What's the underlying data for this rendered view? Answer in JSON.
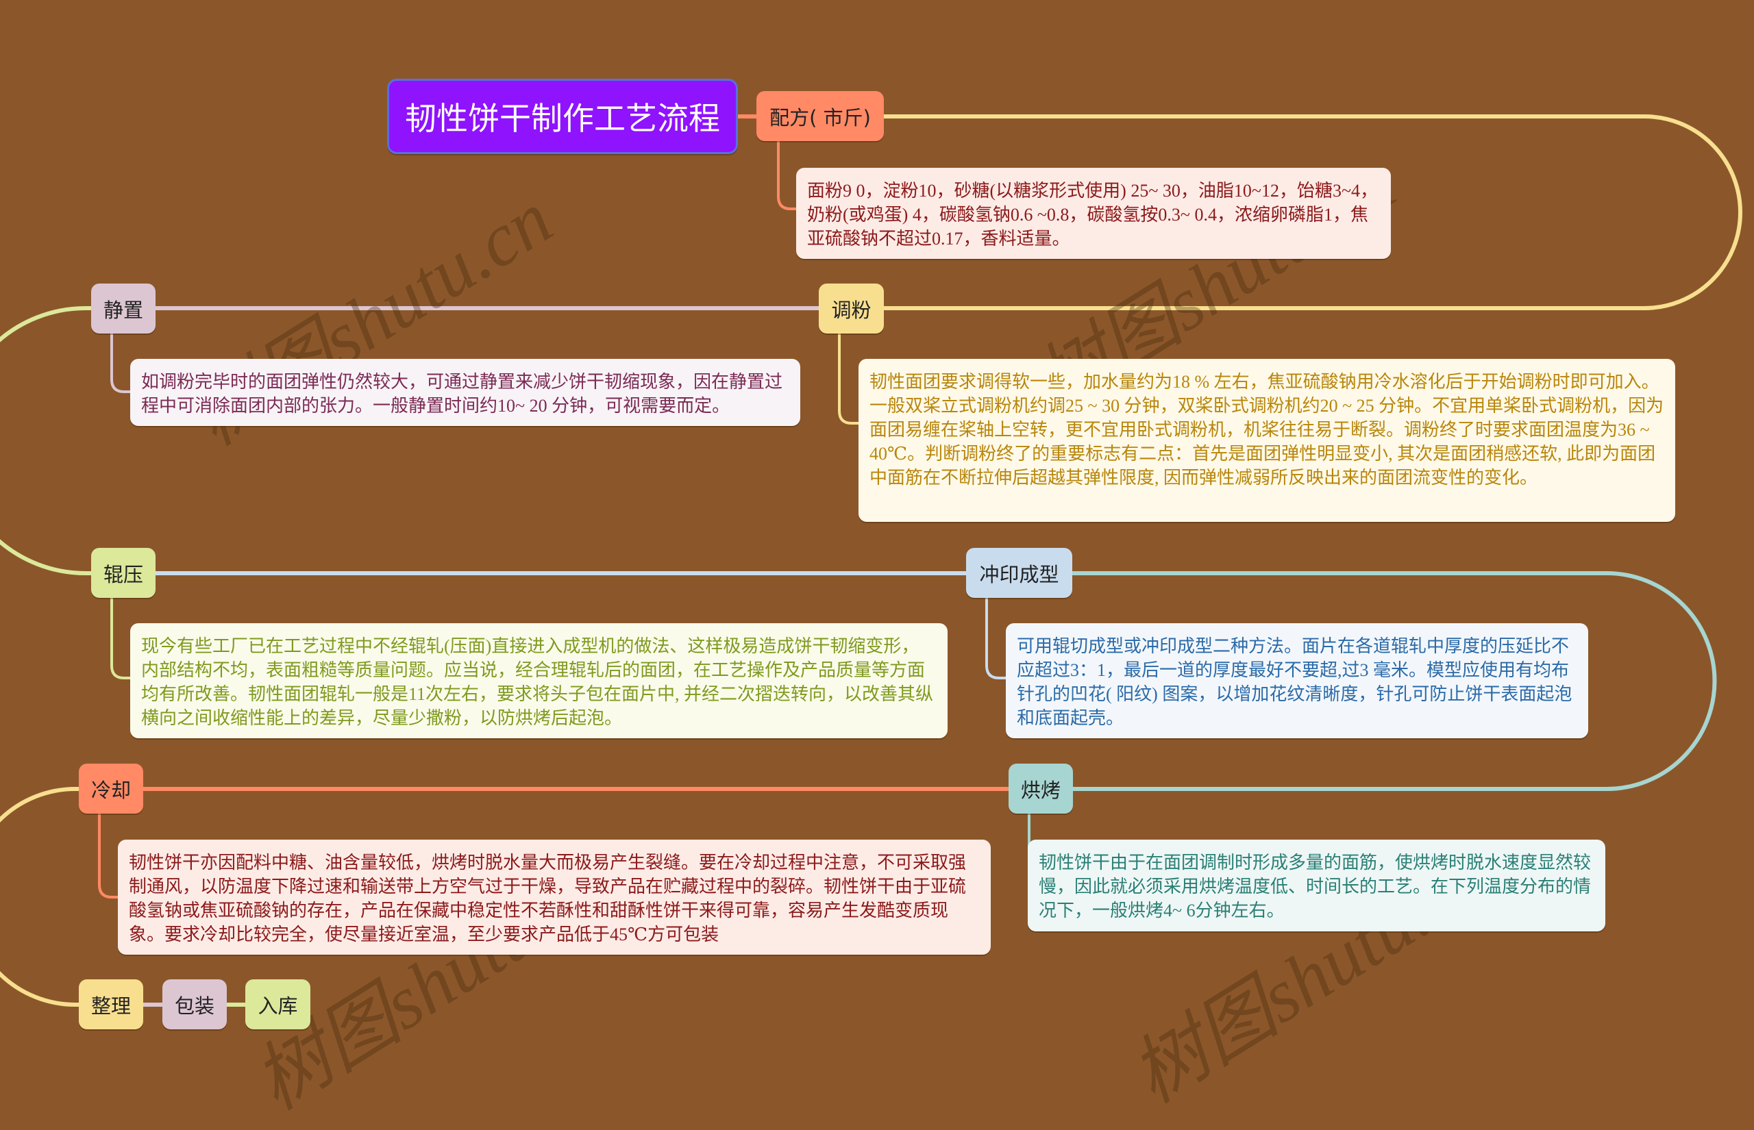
{
  "root": {
    "label": "韧性饼干制作工艺流程",
    "color": "#8F13FD"
  },
  "nodes": [
    {
      "id": "peifang",
      "label": "配方( 市斤)",
      "color": "#FF8A65",
      "detail": "面粉9 0，淀粉10，砂糖(以糖浆形式使用) 25~ 30，油脂10~12，饴糖3~4，奶粉(或鸡蛋) 4，碳酸氢钠0.6 ~0.8，碳酸氢按0.3~ 0.4，浓缩卵磷脂1，焦亚硫酸钠不超过0.17，香料适量。",
      "detail_bg": "#FDEBE6",
      "detail_color": "#8B1A1A"
    },
    {
      "id": "tiaofen",
      "label": "调粉",
      "color": "#F8DF8F",
      "detail": "韧性面团要求调得软一些，加水量约为18 % 左右，焦亚硫酸钠用冷水溶化后于开始调粉时即可加入。一般双桨立式调粉机约调25 ~ 30 分钟，双桨卧式调粉机约20 ~ 25 分钟。不宜用单桨卧式调粉机，因为面团易缠在桨轴上空转，更不宜用卧式调粉机，机桨往往易于断裂。调粉终了时要求面团温度为36 ~ 40℃。判断调粉终了的重要标志有二点：首先是面团弹性明显变小, 其次是面团稍感还软, 此即为面团中面筋在不断拉伸后超越其弹性限度, 因而弹性减弱所反映出来的面团流变性的变化。",
      "detail_bg": "#FEF9E9",
      "detail_color": "#B8860B"
    },
    {
      "id": "jingzhi",
      "label": "静置",
      "color": "#DCC6D2",
      "detail": "如调粉完毕时的面团弹性仍然较大，可通过静置来减少饼干韧缩现象，因在静置过程中可消除面团内部的张力。一般静置时间约10~ 20 分钟，可视需要而定。",
      "detail_bg": "#F8F3F6",
      "detail_color": "#7A2A55"
    },
    {
      "id": "gunya",
      "label": "辊压",
      "color": "#DCE89A",
      "detail": "现今有些工厂已在工艺过程中不经辊轧(压面)直接进入成型机的做法、这样极易造成饼干韧缩变形，内部结构不均，表面粗糙等质量问题。应当说，经合理辊轧后的面团，在工艺操作及产品质量等方面均有所改善。韧性面团辊轧一般是11次左右，要求将头子包在面片中, 并经二次摺迭转向，以改善其纵横向之间收缩性能上的差异，尽量少撒粉，以防烘烤后起泡。",
      "detail_bg": "#FAFBEB",
      "detail_color": "#7F9A1E"
    },
    {
      "id": "chongyin",
      "label": "冲印成型",
      "color": "#C9DCEE",
      "detail": "可用辊切成型或冲印成型二种方法。面片在各道辊轧中厚度的压延比不应超过3：1，最后一道的厚度最好不要超,过3 毫米。模型应使用有均布针孔的凹花( 阳纹) 图案，以增加花纹清晰度，针孔可防止饼干表面起泡和底面起壳。",
      "detail_bg": "#F3F7FB",
      "detail_color": "#2A6AA8"
    },
    {
      "id": "hongkao",
      "label": "烘烤",
      "color": "#A7D5D1",
      "detail": "韧性饼干由于在面团调制时形成多量的面筋，使烘烤时脱水速度显然较慢，因此就必须采用烘烤温度低、时间长的工艺。在下列温度分布的情况下，一般烘烤4~ 6分钟左右。",
      "detail_bg": "#EEF7F6",
      "detail_color": "#2A7F75"
    },
    {
      "id": "lengque",
      "label": "冷却",
      "color": "#FF8A65",
      "detail": "韧性饼干亦因配料中糖、油含量较低，烘烤时脱水量大而极易产生裂缝。要在冷却过程中注意，不可采取强制通风，以防温度下降过速和输送带上方空气过于干燥，导致产品在贮藏过程中的裂碎。韧性饼干由于亚硫酸氢钠或焦亚硫酸钠的存在，产品在保藏中稳定性不若酥性和甜酥性饼干来得可靠，容易产生发酷变质现象。要求冷却比较完全，使尽量接近室温，至少要求产品低于45℃方可包装",
      "detail_bg": "#FDEBE6",
      "detail_color": "#8B1A1A"
    },
    {
      "id": "zhengli",
      "label": "整理",
      "color": "#F8DF8F"
    },
    {
      "id": "baozhuang",
      "label": "包装",
      "color": "#DCC6D2"
    },
    {
      "id": "ruku",
      "label": "入库",
      "color": "#DCE89A"
    }
  ],
  "link_colors": {
    "root_to_peifang": "#FF8A65",
    "peifang_to_tiaofen": "#F8DF8F",
    "tiaofen_to_jingzhi": "#DCC6D2",
    "jingzhi_to_gunya": "#DCE89A",
    "gunya_to_chongyin": "#C9DCEE",
    "chongyin_to_hongkao": "#A7D5D1",
    "hongkao_to_lengque": "#FF8A65",
    "lengque_to_zhengli": "#F8DF8F",
    "zhengli_to_baozhuang": "#DCC6D2",
    "baozhuang_to_ruku": "#DCE89A"
  },
  "watermark": "树图shutu.cn"
}
